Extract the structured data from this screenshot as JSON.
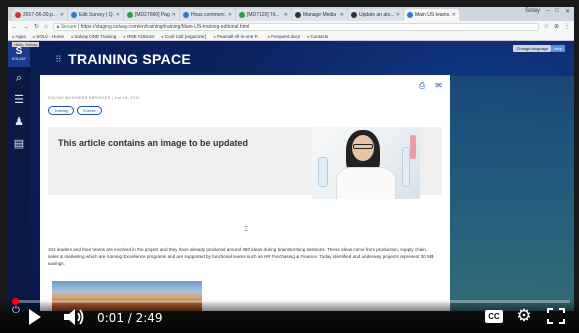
{
  "browser": {
    "tabs": [
      {
        "title": "2017-06-20.p...",
        "color": "#c33"
      },
      {
        "title": "Edit Survey | Q...",
        "color": "#2a7ad8"
      },
      {
        "title": "[MD27660] Page...",
        "color": "#2a9d4a"
      },
      {
        "title": "Hous commerc...",
        "color": "#2a7ad8"
      },
      {
        "title": "[MD7120] Tit...",
        "color": "#2a9d4a"
      },
      {
        "title": "Manage Media",
        "color": "#333"
      },
      {
        "title": "Update an ato...",
        "color": "#333"
      },
      {
        "title": "Main US teams...",
        "color": "#2a7ad8"
      }
    ],
    "user_label": "Solay",
    "url_secure": "Secure",
    "url": "https://staging.solvay.com/en/training/training/Main-US-training-editorial.html",
    "bookmarks": [
      "Apps",
      "SOLV - Home",
      "Solvay ONE Training",
      "ONE AODocs",
      "Conf Call (organizer)",
      "Pearsall All-in-one P...",
      "Frequent docs",
      "Contacts"
    ]
  },
  "sidebar": {
    "brand_letter": "S",
    "brand_word": "SOLVAY",
    "hello": "Hello, Solvay",
    "icons": [
      "search-icon",
      "menu-icon",
      "user-icon",
      "card-icon"
    ]
  },
  "banner": {
    "title": "TRAINING SPACE",
    "lang_button": "Change language",
    "help_button": "Help"
  },
  "article": {
    "meta": "SOLVAY BUSINESS SERVICES  |  Jun 15, 2017",
    "tags": [
      "Training",
      "Events"
    ],
    "hero_title": "This article contains an image to be updated",
    "body": "104 leaders and their teams are involved in the project and they have already produced around 350 ideas during brainstorming sessions. These ideas come from production, supply chain, sales & marketing which are running Excellence programs and are supported by functional teams such as HR Purchasing & Finance. Today identified and underway projects represent 30 M$ savings."
  },
  "video": {
    "time": "0:01 / 2:49",
    "progress_fraction": 0.006,
    "cc_label": "CC",
    "progress_color": "#ff0000"
  }
}
